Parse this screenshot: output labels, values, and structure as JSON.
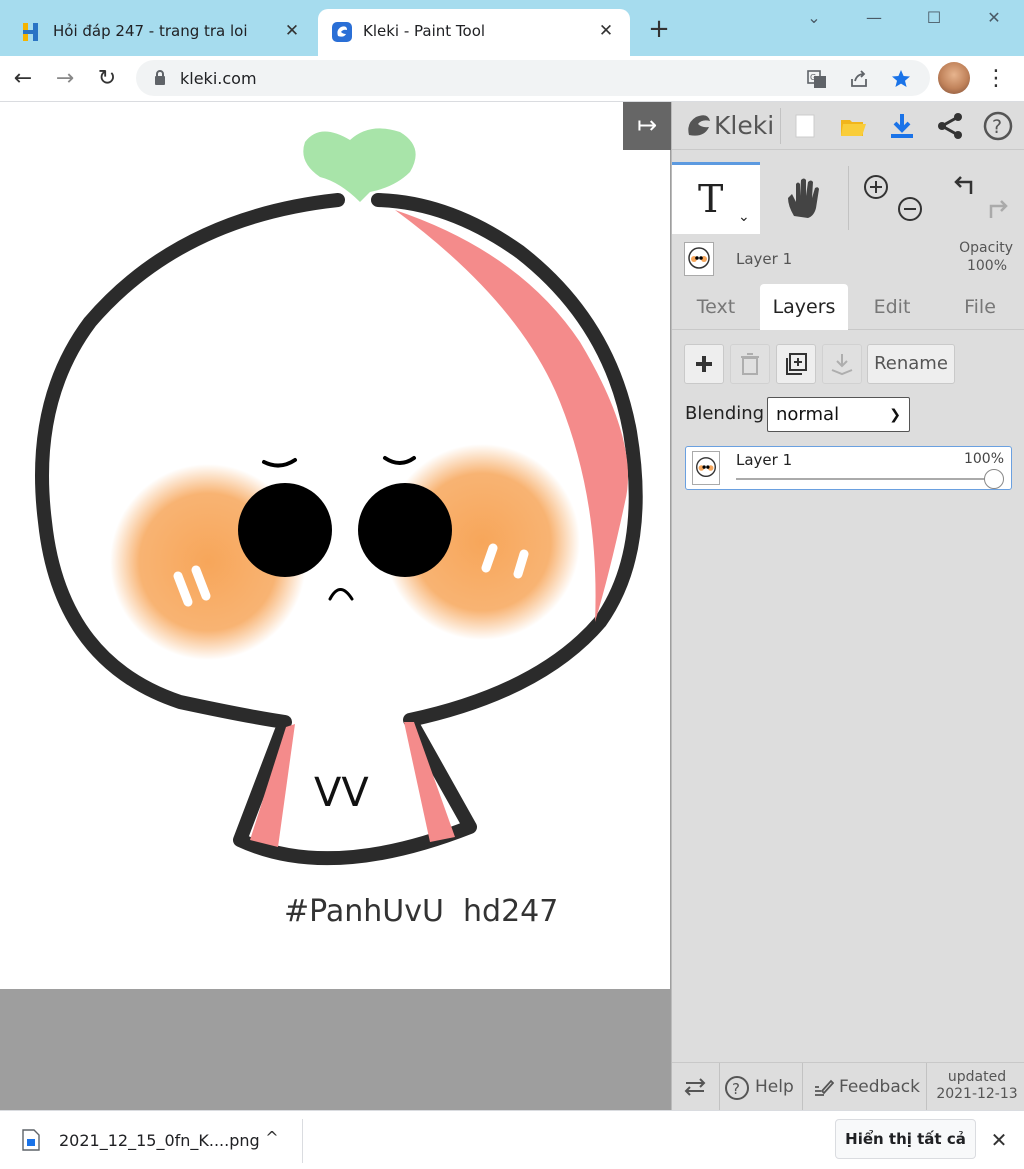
{
  "browser": {
    "tabs": [
      {
        "title": "Hỏi đáp 247 - trang tra loi",
        "active": false
      },
      {
        "title": "Kleki - Paint Tool",
        "active": true
      }
    ],
    "new_tab_label": "+",
    "url": "kleki.com",
    "window_controls": {
      "dropdown": "⌄",
      "minimize": "—",
      "maximize": "☐",
      "close": "✕"
    }
  },
  "canvas": {
    "caption": "#PanhUvU  hd247",
    "mouth_text": "VV",
    "colors": {
      "outline": "#2b2b2b",
      "sprout": "#a8e4a9",
      "blush": "#f7a65a",
      "shade": "#f48b8b",
      "eyes": "#000000"
    }
  },
  "kleki": {
    "brand": "Kleki",
    "active_layer": {
      "name": "Layer 1",
      "opacity_label": "Opacity",
      "opacity_value": "100%"
    },
    "tabs": [
      "Text",
      "Layers",
      "Edit",
      "File"
    ],
    "selected_tab": "Layers",
    "layer_buttons": {
      "rename_label": "Rename"
    },
    "blending": {
      "label": "Blending",
      "value": "normal"
    },
    "layers": [
      {
        "name": "Layer 1",
        "opacity": "100%",
        "opacity_fraction": 1.0
      }
    ],
    "footer": {
      "help": "Help",
      "feedback": "Feedback",
      "updated_label": "updated",
      "updated_date": "2021-12-13"
    },
    "accent": "#5c9ae0"
  },
  "downloads": {
    "file_name": "2021_12_15_0fn_K....png",
    "show_all": "Hiển thị tất cả"
  }
}
